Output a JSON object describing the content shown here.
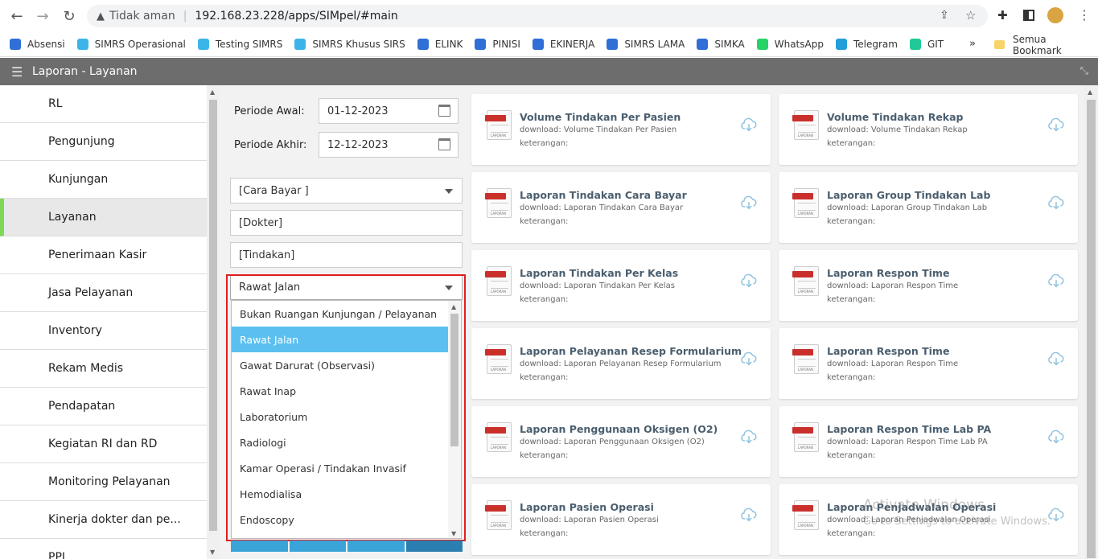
{
  "browser": {
    "not_secure_label": "Tidak aman",
    "url": "192.168.23.228/apps/SIMpel/#main",
    "bookmarks": [
      {
        "label": "Absensi",
        "color": "#2f6fd6"
      },
      {
        "label": "SIMRS Operasional",
        "color": "#3bb5e8"
      },
      {
        "label": "Testing SIMRS",
        "color": "#3bb5e8"
      },
      {
        "label": "SIMRS Khusus SIRS",
        "color": "#3bb5e8"
      },
      {
        "label": "ELINK",
        "color": "#2f6fd6"
      },
      {
        "label": "PINISI",
        "color": "#2f6fd6"
      },
      {
        "label": "EKINERJA",
        "color": "#2f6fd6"
      },
      {
        "label": "SIMRS LAMA",
        "color": "#2f6fd6"
      },
      {
        "label": "SIMKA",
        "color": "#2f6fd6"
      },
      {
        "label": "WhatsApp",
        "color": "#25d366"
      },
      {
        "label": "Telegram",
        "color": "#229ed9"
      },
      {
        "label": "GIT",
        "color": "#20c997"
      }
    ],
    "more_label": "»",
    "all_bookmarks_label": "Semua Bookmark"
  },
  "app": {
    "title": "Laporan - Layanan"
  },
  "sidebar": {
    "items": [
      {
        "label": "RL",
        "active": false
      },
      {
        "label": "Pengunjung",
        "active": false
      },
      {
        "label": "Kunjungan",
        "active": false
      },
      {
        "label": "Layanan",
        "active": true
      },
      {
        "label": "Penerimaan Kasir",
        "active": false
      },
      {
        "label": "Jasa Pelayanan",
        "active": false
      },
      {
        "label": "Inventory",
        "active": false
      },
      {
        "label": "Rekam Medis",
        "active": false
      },
      {
        "label": "Pendapatan",
        "active": false
      },
      {
        "label": "Kegiatan RI dan RD",
        "active": false
      },
      {
        "label": "Monitoring Pelayanan",
        "active": false
      },
      {
        "label": "Kinerja dokter dan pe...",
        "active": false
      },
      {
        "label": "PPI",
        "active": false
      }
    ]
  },
  "filters": {
    "periode_awal_label": "Periode Awal:",
    "periode_awal_value": "01-12-2023",
    "periode_akhir_label": "Periode Akhir:",
    "periode_akhir_value": "12-12-2023",
    "cara_bayar": "[Cara Bayar ]",
    "dokter": "[Dokter]",
    "tindakan": "[Tindakan]",
    "ruangan_selected": "Rawat Jalan",
    "ruangan_options": [
      {
        "label": "Bukan Ruangan Kunjungan / Pelayanan",
        "selected": false
      },
      {
        "label": "Rawat Jalan",
        "selected": true
      },
      {
        "label": "Gawat Darurat (Observasi)",
        "selected": false
      },
      {
        "label": "Rawat Inap",
        "selected": false
      },
      {
        "label": "Laboratorium",
        "selected": false
      },
      {
        "label": "Radiologi",
        "selected": false
      },
      {
        "label": "Kamar Operasi / Tindakan Invasif",
        "selected": false
      },
      {
        "label": "Hemodialisa",
        "selected": false
      },
      {
        "label": "Endoscopy",
        "selected": false
      }
    ]
  },
  "reports": [
    {
      "title": "Volume Tindakan Per Pasien",
      "download": "download: Volume Tindakan Per Pasien",
      "note": "keterangan:"
    },
    {
      "title": "Volume Tindakan Rekap",
      "download": "download: Volume Tindakan Rekap",
      "note": "keterangan:"
    },
    {
      "title": "Laporan Tindakan Cara Bayar",
      "download": "download: Laporan Tindakan Cara Bayar",
      "note": "keterangan:"
    },
    {
      "title": "Laporan Group Tindakan Lab",
      "download": "download: Laporan Group Tindakan Lab",
      "note": "keterangan:"
    },
    {
      "title": "Laporan Tindakan Per Kelas",
      "download": "download: Laporan Tindakan Per Kelas",
      "note": "keterangan:"
    },
    {
      "title": "Laporan Respon Time",
      "download": "download: Laporan Respon Time",
      "note": "keterangan:"
    },
    {
      "title": "Laporan Pelayanan Resep Formularium",
      "download": "download: Laporan Pelayanan Resep Formularium",
      "note": "keterangan:"
    },
    {
      "title": "Laporan Respon Time",
      "download": "download: Laporan Respon Time",
      "note": "keterangan:"
    },
    {
      "title": "Laporan Penggunaan Oksigen (O2)",
      "download": "download: Laporan Penggunaan Oksigen (O2)",
      "note": "keterangan:"
    },
    {
      "title": "Laporan Respon Time Lab PA",
      "download": "download: Laporan Respon Time Lab PA",
      "note": "keterangan:"
    },
    {
      "title": "Laporan Pasien Operasi",
      "download": "download: Laporan Pasien Operasi",
      "note": "keterangan:"
    },
    {
      "title": "Laporan Penjadwalan Operasi",
      "download": "download: Laporan Penjadwalan Operasi",
      "note": "keterangan:"
    }
  ],
  "pdf_icon_tag": "LAPORAN",
  "watermark": {
    "line1": "Activate Windows",
    "line2": "Go to Settings to activate Windows."
  }
}
